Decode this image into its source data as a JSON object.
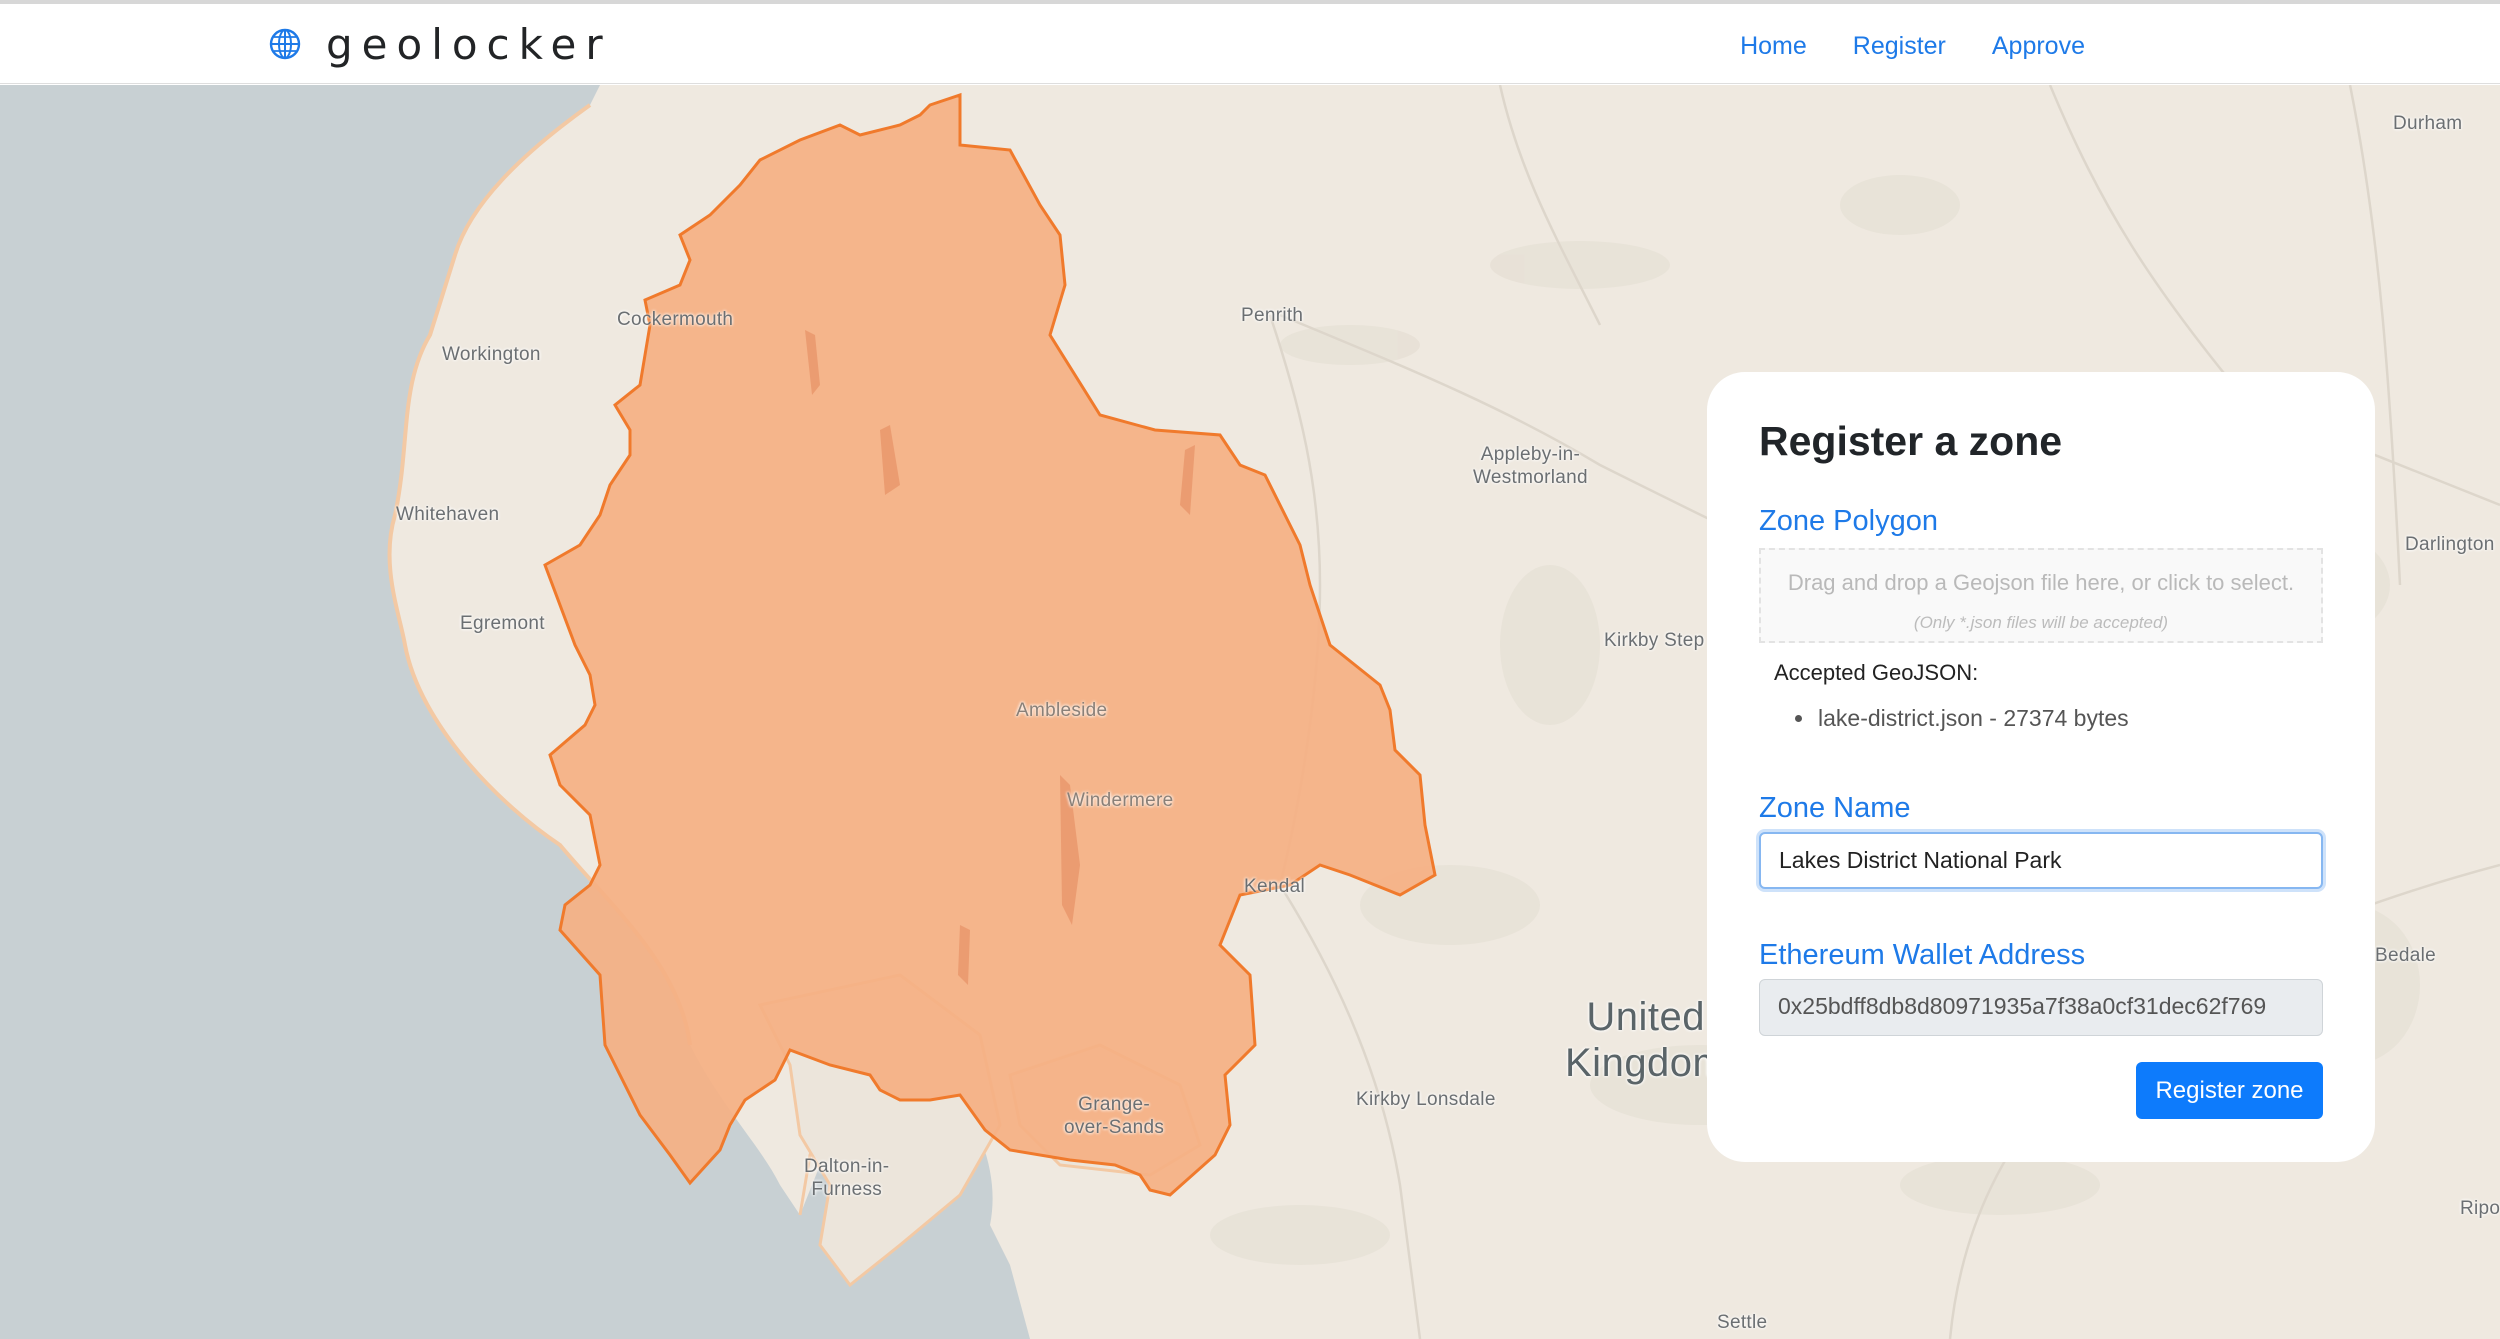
{
  "app": {
    "brand_name": "geolocker",
    "brand_icon": "globe-icon",
    "accent_color": "#1e7ae8"
  },
  "nav": {
    "items": [
      {
        "label": "Home"
      },
      {
        "label": "Register"
      },
      {
        "label": "Approve"
      }
    ]
  },
  "map": {
    "labels": {
      "durham": "Durham",
      "cockermouth": "Cockermouth",
      "penrith": "Penrith",
      "workington": "Workington",
      "appleby": "Appleby-in-\nWestmorland",
      "whitehaven": "Whitehaven",
      "darlington": "Darlington",
      "egremont": "Egremont",
      "kirkby_stephen": "Kirkby Step",
      "ambleside": "Ambleside",
      "windermere": "Windermere",
      "kendal": "Kendal",
      "bedale": "Bedale",
      "uk": "United\nKingdom",
      "grange": "Grange-\nover-Sands",
      "kirkby_lonsdale": "Kirkby Lonsdale",
      "dalton": "Dalton-in-\nFurness",
      "ripon": "Ripo",
      "settle": "Settle"
    },
    "polygon_fill": "#f5b083",
    "polygon_stroke": "#f07a2c"
  },
  "form": {
    "title": "Register a zone",
    "zone_polygon_label": "Zone Polygon",
    "dropzone_text": "Drag and drop a Geojson file here, or click to select.",
    "dropzone_hint": "(Only *.json files will be accepted)",
    "accepted_title": "Accepted GeoJSON:",
    "accepted_files": [
      "lake-district.json - 27374 bytes"
    ],
    "zone_name_label": "Zone Name",
    "zone_name_value": "Lakes District National Park",
    "wallet_label": "Ethereum Wallet Address",
    "wallet_value": "0x25bdff8db8d80971935a7f38a0cf31dec62f769",
    "submit_label": "Register zone",
    "submit_color": "#0d7bfc"
  }
}
